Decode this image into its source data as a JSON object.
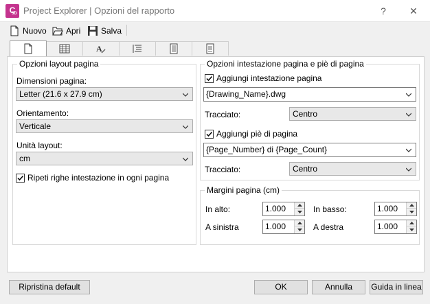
{
  "window": {
    "app_icon_letter": "C",
    "app_icon_sub": "3D",
    "title": "Project Explorer | Opzioni del rapporto",
    "help_glyph": "?",
    "close_glyph": "✕"
  },
  "toolbar": {
    "new_label": "Nuovo",
    "open_label": "Apri",
    "save_label": "Salva"
  },
  "tabs": [
    {
      "icon": "page-icon",
      "active": true
    },
    {
      "icon": "table-icon",
      "active": false
    },
    {
      "icon": "text-format-icon",
      "active": false
    },
    {
      "icon": "list-lines-icon",
      "active": false
    },
    {
      "icon": "document-lines-icon",
      "active": false
    },
    {
      "icon": "document-lines-alt-icon",
      "active": false
    }
  ],
  "layout_group": {
    "title": "Opzioni layout pagina",
    "page_size_label": "Dimensioni pagina:",
    "page_size_value": "Letter (21.6 x 27.9 cm)",
    "orientation_label": "Orientamento:",
    "orientation_value": "Verticale",
    "units_label": "Unità layout:",
    "units_value": "cm",
    "repeat_header_label": "Ripeti righe intestazione in ogni pagina",
    "repeat_header_checked": true
  },
  "header_footer_group": {
    "title": "Opzioni intestazione pagina e piè di pagina",
    "add_header_label": "Aggiungi intestazione pagina",
    "add_header_checked": true,
    "header_value": "{Drawing_Name}.dwg",
    "header_align_label": "Tracciato:",
    "header_align_value": "Centro",
    "add_footer_label": "Aggiungi piè di pagina",
    "add_footer_checked": true,
    "footer_value": "{Page_Number} di {Page_Count}",
    "footer_align_label": "Tracciato:",
    "footer_align_value": "Centro"
  },
  "margins_group": {
    "title": "Margini pagina (cm)",
    "top_label": "In alto:",
    "top_value": "1.000",
    "bottom_label": "In basso:",
    "bottom_value": "1.000",
    "left_label": "A sinistra",
    "left_value": "1.000",
    "right_label": "A destra",
    "right_value": "1.000"
  },
  "footer_buttons": {
    "reset_label": "Ripristina default",
    "ok_label": "OK",
    "cancel_label": "Annulla",
    "help_label": "Guida in linea"
  },
  "colors": {
    "app_icon": "#c4338e",
    "panel_bg": "#ffffff",
    "dialog_bg": "#f0f0f0",
    "button_bg": "#e1e1e1"
  }
}
